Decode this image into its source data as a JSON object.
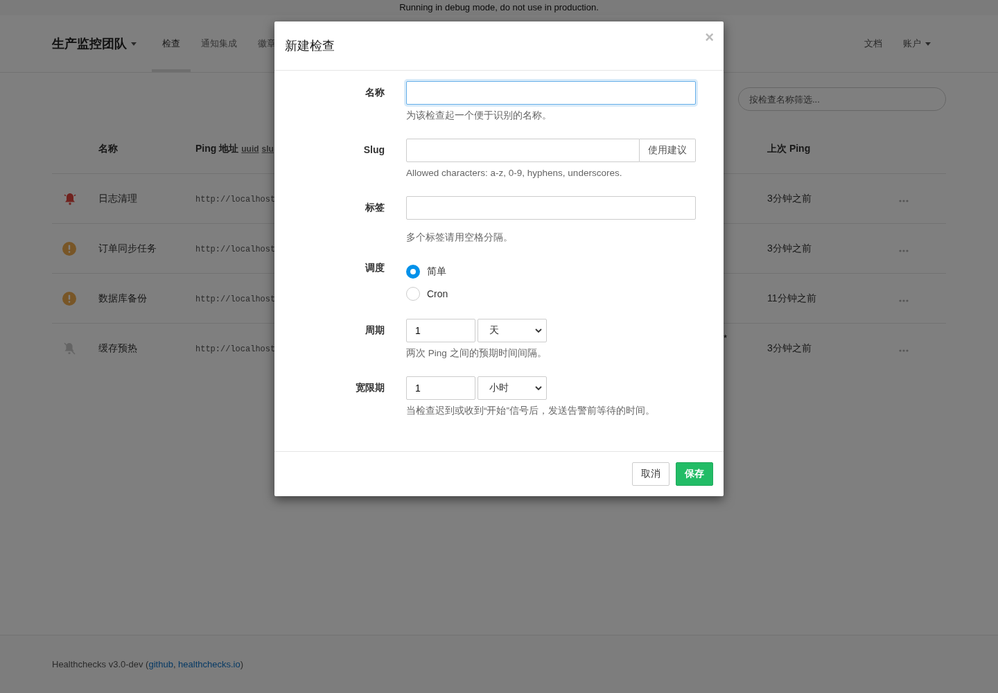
{
  "debug_banner": "Running in debug mode, do not use in production.",
  "navbar": {
    "brand": "生产监控团队",
    "tabs": [
      {
        "label": "检查",
        "selected": true
      },
      {
        "label": "通知集成",
        "selected": false
      },
      {
        "label": "徽章",
        "selected": false
      }
    ],
    "right_links": [
      {
        "label": "文档",
        "dropdown": false
      },
      {
        "label": "账户",
        "dropdown": true
      }
    ]
  },
  "filter": {
    "placeholder": "按检查名称筛选..."
  },
  "table": {
    "columns": [
      {
        "label": "名称"
      },
      {
        "label": "Ping 地址",
        "links": [
          "uuid",
          "slu"
        ]
      },
      {
        "label": "上次 Ping"
      }
    ],
    "rows": [
      {
        "kind": "down",
        "name": "日志清理",
        "ping_url": "http://localhost",
        "last_ping": "3分钟之前"
      },
      {
        "kind": "grace",
        "name": "订单同步任务",
        "ping_url": "http://localhost",
        "last_ping": "3分钟之前"
      },
      {
        "kind": "grace",
        "name": "数据库备份",
        "ping_url": "http://localhost",
        "last_ping": "11分钟之前"
      },
      {
        "kind": "paused",
        "name": "缓存预热",
        "ping_url": "http://localhost",
        "column_3": "*",
        "last_ping": "3分钟之前"
      }
    ]
  },
  "footer": {
    "parts": [
      {
        "kind": "text",
        "text": "Healthchecks v3.0-dev ("
      },
      {
        "kind": "link",
        "text": "github"
      },
      {
        "kind": "text",
        "text": ", "
      },
      {
        "kind": "link",
        "text": "healthchecks.io"
      },
      {
        "kind": "text",
        "text": ")"
      }
    ]
  },
  "modal": {
    "title": "新建检查",
    "close": "×",
    "fields": [
      {
        "kind": "text",
        "label": "名称",
        "focused": true,
        "help": "为该检查起一个便于识别的名称。"
      },
      {
        "kind": "addon",
        "label": "Slug",
        "button": "使用建议",
        "help": "Allowed characters: a-z, 0-9, hyphens, underscores."
      },
      {
        "kind": "text",
        "label": "标签",
        "focused": false,
        "help": "多个标签请用空格分隔。"
      },
      {
        "kind": "radio",
        "label": "调度",
        "options": [
          {
            "label": "简单",
            "selected": true
          },
          {
            "label": "Cron",
            "selected": false
          }
        ]
      },
      {
        "kind": "duration",
        "label": "周期",
        "value": "1",
        "unit": "天",
        "help": "两次 Ping 之间的预期时间间隔。"
      },
      {
        "kind": "duration",
        "label": "宽限期",
        "value": "1",
        "unit": "小时",
        "help": "当检查迟到或收到“开始”信号后，发送告警前等待的时间。"
      }
    ],
    "buttons": [
      {
        "label": "取消",
        "kind": "default"
      },
      {
        "label": "保存",
        "kind": "primary"
      }
    ]
  }
}
